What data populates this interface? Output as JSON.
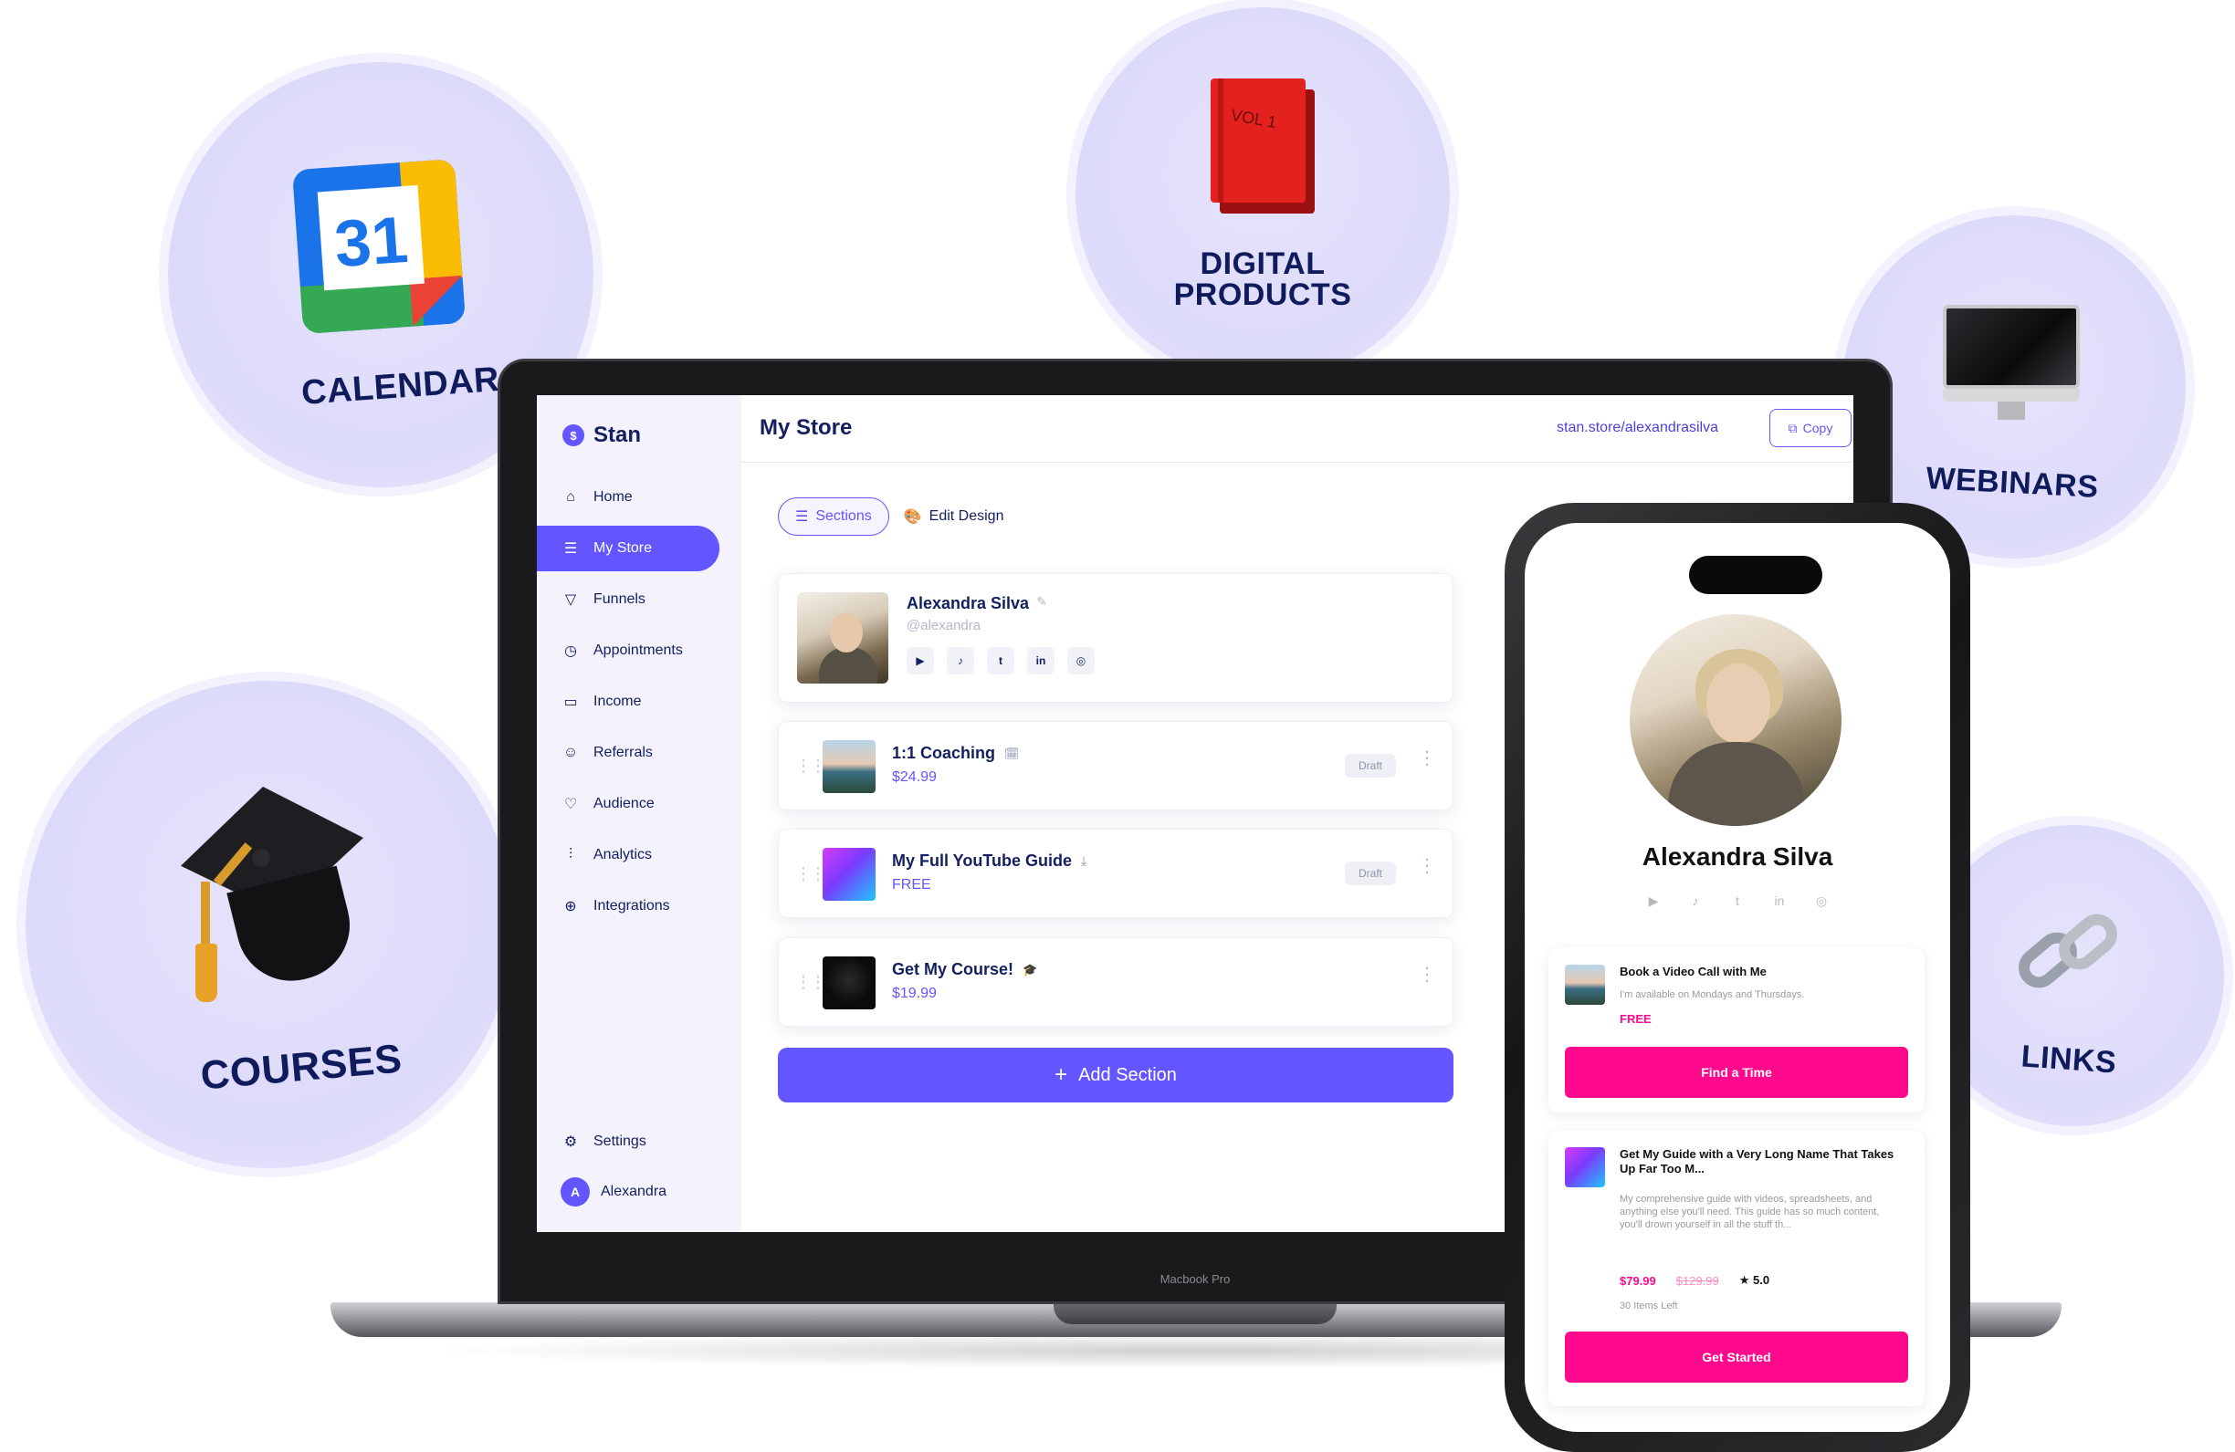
{
  "bubbles": {
    "calendar": {
      "label": "CALENDAR",
      "icon_text": "31"
    },
    "digital_products": {
      "label_line1": "DIGITAL",
      "label_line2": "PRODUCTS",
      "book_text": "VOL 1"
    },
    "webinars": {
      "label": "WEBINARS"
    },
    "courses": {
      "label": "COURSES"
    },
    "links": {
      "label": "LINKS"
    }
  },
  "laptop": {
    "model_label": "Macbook Pro"
  },
  "sidebar": {
    "brand": "Stan",
    "brand_mark": "$",
    "items": [
      {
        "label": "Home",
        "icon": "home-icon",
        "glyph": "⌂"
      },
      {
        "label": "My Store",
        "icon": "store-icon",
        "glyph": "☰"
      },
      {
        "label": "Funnels",
        "icon": "funnel-icon",
        "glyph": "▽"
      },
      {
        "label": "Appointments",
        "icon": "clock-icon",
        "glyph": "◷"
      },
      {
        "label": "Income",
        "icon": "wallet-icon",
        "glyph": "▭"
      },
      {
        "label": "Referrals",
        "icon": "smile-icon",
        "glyph": "☺"
      },
      {
        "label": "Audience",
        "icon": "heart-icon",
        "glyph": "♡"
      },
      {
        "label": "Analytics",
        "icon": "bar-chart-icon",
        "glyph": "⫶"
      },
      {
        "label": "Integrations",
        "icon": "plus-circle-icon",
        "glyph": "⊕"
      }
    ],
    "settings_label": "Settings",
    "user_initial": "A",
    "user_name": "Alexandra"
  },
  "header": {
    "title": "My Store",
    "store_url": "stan.store/alexandrasilva",
    "copy_label": "Copy"
  },
  "tabs": [
    {
      "label": "Sections",
      "active": true
    },
    {
      "label": "Edit Design",
      "active": false
    }
  ],
  "profile": {
    "name": "Alexandra Silva",
    "handle": "@alexandra",
    "socials": [
      "▶",
      "♪",
      "t",
      "in",
      "◎"
    ]
  },
  "products": [
    {
      "title": "1:1 Coaching",
      "price": "$24.99",
      "status": "Draft",
      "type_icon": "🗓"
    },
    {
      "title": "My Full YouTube Guide",
      "price": "FREE",
      "status": "Draft",
      "type_icon": "⤓"
    },
    {
      "title": "Get My Course!",
      "price": "$19.99",
      "status": "",
      "type_icon": "🎓"
    }
  ],
  "add_section_label": "Add Section",
  "phone": {
    "name": "Alexandra Silva",
    "socials": [
      "▶",
      "♪",
      "t",
      "in",
      "◎"
    ],
    "card1": {
      "title": "Book a Video Call with Me",
      "desc": "I'm available on Mondays and Thursdays.",
      "price": "FREE",
      "cta": "Find a Time"
    },
    "card2": {
      "title": "Get My Guide with a Very Long Name That Takes Up Far Too M...",
      "desc": "My comprehensive guide with videos, spreadsheets, and anything else you'll need. This guide has so much content, you'll drown yourself in all the stuff th...",
      "price": "$79.99",
      "old_price": "$129.99",
      "rating": "5.0",
      "stock": "30 Items Left",
      "cta": "Get Started"
    }
  },
  "colors": {
    "accent": "#6355ff",
    "navy": "#131f60",
    "pink_cta": "#ff0a8c",
    "bubble": "#dcdafa"
  }
}
